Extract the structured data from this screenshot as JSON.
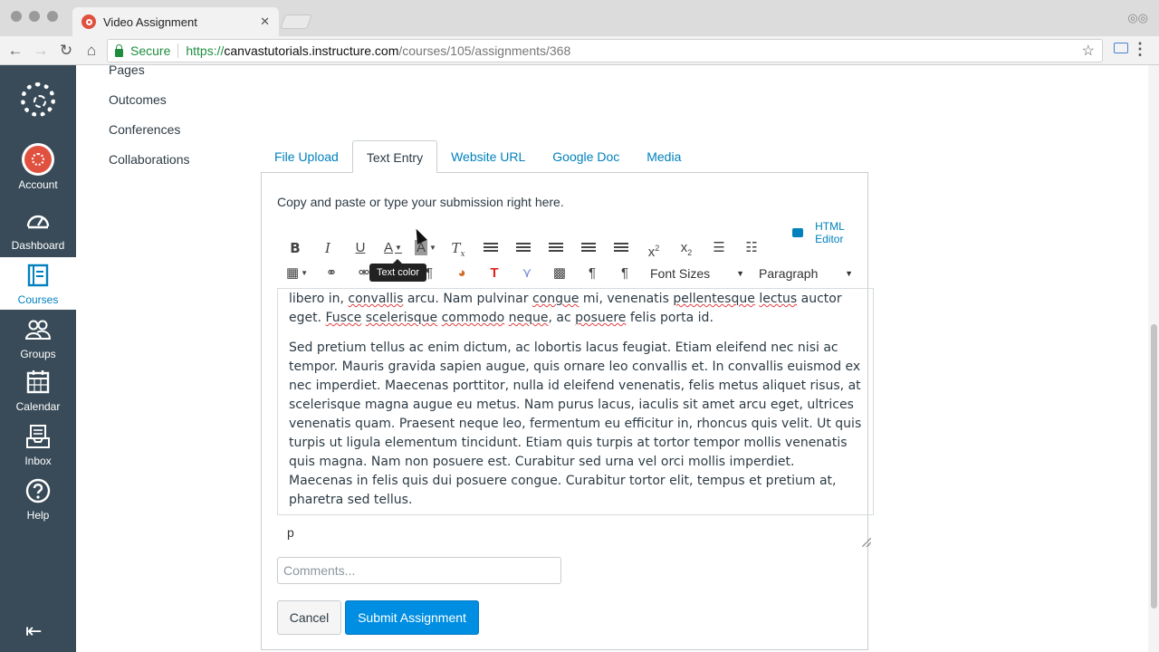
{
  "browser": {
    "tab_title": "Video Assignment",
    "tab_close": "✕",
    "secure_label": "Secure",
    "url_scheme": "https://",
    "url_host": "canvastutorials.instructure.com",
    "url_path": "/courses/105/assignments/368"
  },
  "global_nav": {
    "items": [
      {
        "label": "Account"
      },
      {
        "label": "Dashboard"
      },
      {
        "label": "Courses"
      },
      {
        "label": "Groups"
      },
      {
        "label": "Calendar"
      },
      {
        "label": "Inbox"
      },
      {
        "label": "Help"
      }
    ],
    "active": "Courses"
  },
  "course_nav": {
    "items": [
      "Pages",
      "Outcomes",
      "Conferences",
      "Collaborations"
    ]
  },
  "submission": {
    "tabs": [
      "File Upload",
      "Text Entry",
      "Website URL",
      "Google Doc",
      "Media"
    ],
    "active_tab": "Text Entry",
    "instructions": "Copy and paste or type your submission right here.",
    "html_editor_label": "HTML Editor",
    "tooltip": "Text color",
    "font_sizes_label": "Font Sizes",
    "paragraph_label": "Paragraph",
    "paragraph_1": {
      "a": "libero in, ",
      "b": "convallis",
      "c": " arcu. Nam pulvinar ",
      "d": "congue",
      "e": " mi, venenatis ",
      "f": "pellentesque",
      "g": " ",
      "h": "lectus",
      "i": " auctor eget. ",
      "j": "Fusce",
      "k": " ",
      "l": "scelerisque",
      "m": " ",
      "n": "commodo",
      "o": " ",
      "p": "neque",
      "q": ", ac ",
      "r": "posuere",
      "s": " felis porta id."
    },
    "paragraph_2": "Sed pretium tellus ac enim dictum, ac lobortis lacus feugiat. Etiam eleifend nec nisi ac tempor. Mauris gravida sapien augue, quis ornare leo convallis et. In convallis euismod ex nec imperdiet. Maecenas porttitor, nulla id eleifend venenatis, felis metus aliquet risus, at scelerisque magna augue eu metus. Nam purus lacus, iaculis sit amet arcu eget, ultrices venenatis quam. Praesent neque leo, fermentum eu efficitur in, rhoncus quis velit. Ut quis turpis ut ligula elementum tincidunt. Etiam quis turpis at tortor tempor mollis venenatis quis magna. Nam non posuere est. Curabitur sed urna vel orci mollis imperdiet. Maecenas in felis quis dui posuere congue. Curabitur tortor elit, tempus et pretium at, pharetra sed tellus.",
    "element_path": "p",
    "comments_placeholder": "Comments...",
    "cancel_label": "Cancel",
    "submit_label": "Submit Assignment"
  }
}
